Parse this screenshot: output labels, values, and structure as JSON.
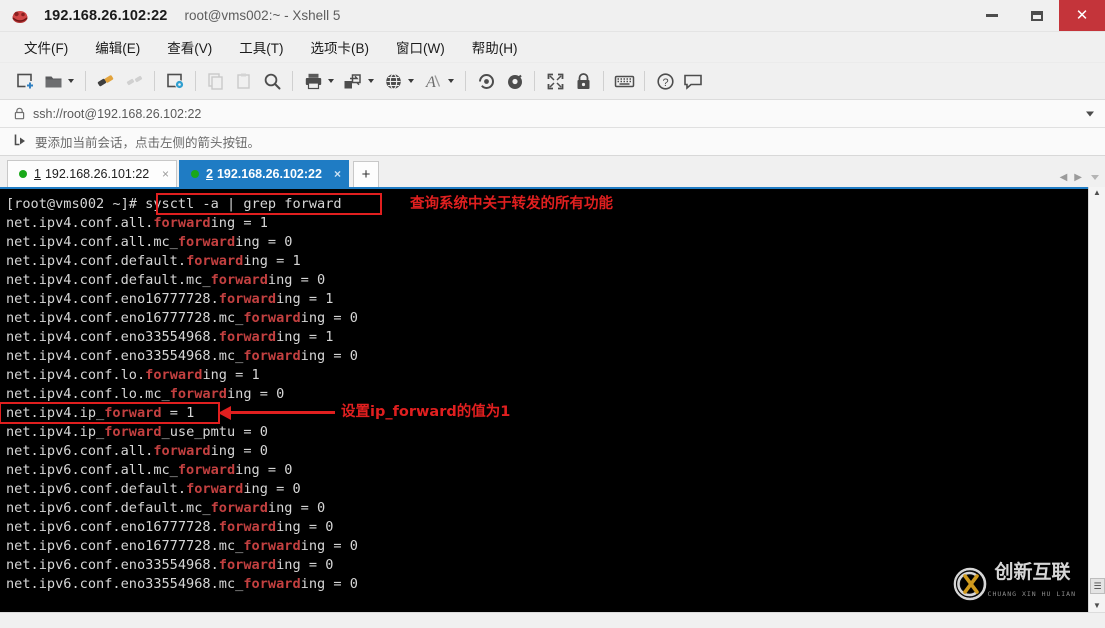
{
  "window": {
    "host": "192.168.26.102:22",
    "subtitle": "root@vms002:~ - Xshell 5",
    "app_icon": "xshell-icon",
    "minimize_label": "—",
    "maximize_label": "□",
    "close_label": "✕"
  },
  "menubar": {
    "items": [
      {
        "name": "file",
        "label": "文件(F)"
      },
      {
        "name": "edit",
        "label": "编辑(E)"
      },
      {
        "name": "view",
        "label": "查看(V)"
      },
      {
        "name": "tools",
        "label": "工具(T)"
      },
      {
        "name": "tabs",
        "label": "选项卡(B)"
      },
      {
        "name": "window",
        "label": "窗口(W)"
      },
      {
        "name": "help",
        "label": "帮助(H)"
      }
    ]
  },
  "toolbar": {
    "items": [
      {
        "name": "new-session-icon",
        "kind": "icon",
        "caret": false
      },
      {
        "name": "open-folder-icon",
        "kind": "icon",
        "caret": true
      },
      {
        "name": "separator",
        "kind": "sep"
      },
      {
        "name": "connect-icon",
        "kind": "icon",
        "caret": false
      },
      {
        "name": "disconnect-icon",
        "kind": "icon",
        "caret": false,
        "dim": true
      },
      {
        "name": "separator",
        "kind": "sep"
      },
      {
        "name": "session-properties-icon",
        "kind": "icon",
        "caret": false
      },
      {
        "name": "separator",
        "kind": "sep"
      },
      {
        "name": "copy-icon",
        "kind": "icon",
        "caret": false,
        "dim": true
      },
      {
        "name": "paste-icon",
        "kind": "icon",
        "caret": false,
        "dim": true
      },
      {
        "name": "find-icon",
        "kind": "icon",
        "caret": false
      },
      {
        "name": "separator",
        "kind": "sep"
      },
      {
        "name": "print-icon",
        "kind": "icon",
        "caret": true
      },
      {
        "name": "file-transfer-icon",
        "kind": "icon",
        "caret": true
      },
      {
        "name": "encoding-globe-icon",
        "kind": "icon",
        "caret": true
      },
      {
        "name": "font-icon",
        "kind": "icon",
        "caret": true
      },
      {
        "name": "separator",
        "kind": "sep"
      },
      {
        "name": "compose-bar-icon",
        "kind": "icon",
        "caret": false
      },
      {
        "name": "highlight-icon",
        "kind": "icon",
        "caret": false
      },
      {
        "name": "separator",
        "kind": "sep"
      },
      {
        "name": "fullscreen-icon",
        "kind": "icon",
        "caret": false
      },
      {
        "name": "lock-icon",
        "kind": "icon",
        "caret": false
      },
      {
        "name": "separator",
        "kind": "sep"
      },
      {
        "name": "keyboard-icon",
        "kind": "icon",
        "caret": false
      },
      {
        "name": "separator",
        "kind": "sep"
      },
      {
        "name": "help-icon",
        "kind": "icon",
        "caret": false
      },
      {
        "name": "feedback-icon",
        "kind": "icon",
        "caret": false
      }
    ]
  },
  "address": {
    "value": "ssh://root@192.168.26.102:22",
    "lock_icon": "lock-icon",
    "dropdown_icon": "chevron-down-icon"
  },
  "hint": {
    "icon": "arrow-add-icon",
    "text": "要添加当前会话，点击左侧的箭头按钮。"
  },
  "tabs": {
    "items": [
      {
        "name": "tab-101",
        "num": "1",
        "label": "192.168.26.101:22",
        "active": false,
        "close_label": "×"
      },
      {
        "name": "tab-102",
        "num": "2",
        "label": "192.168.26.102:22",
        "active": true,
        "close_label": "×"
      }
    ],
    "add_label": "+",
    "nav_prev": "◀",
    "nav_next": "▶"
  },
  "terminal": {
    "prompt": "[root@vms002 ~]# ",
    "command": "sysctl -a | grep forward",
    "lines": [
      [
        [
          "plain",
          "net.ipv4.conf.all."
        ],
        [
          "hl",
          "forward"
        ],
        [
          "plain",
          "ing = 1"
        ]
      ],
      [
        [
          "plain",
          "net.ipv4.conf.all.mc_"
        ],
        [
          "hl",
          "forward"
        ],
        [
          "plain",
          "ing = 0"
        ]
      ],
      [
        [
          "plain",
          "net.ipv4.conf.default."
        ],
        [
          "hl",
          "forward"
        ],
        [
          "plain",
          "ing = 1"
        ]
      ],
      [
        [
          "plain",
          "net.ipv4.conf.default.mc_"
        ],
        [
          "hl",
          "forward"
        ],
        [
          "plain",
          "ing = 0"
        ]
      ],
      [
        [
          "plain",
          "net.ipv4.conf.eno16777728."
        ],
        [
          "hl",
          "forward"
        ],
        [
          "plain",
          "ing = 1"
        ]
      ],
      [
        [
          "plain",
          "net.ipv4.conf.eno16777728.mc_"
        ],
        [
          "hl",
          "forward"
        ],
        [
          "plain",
          "ing = 0"
        ]
      ],
      [
        [
          "plain",
          "net.ipv4.conf.eno33554968."
        ],
        [
          "hl",
          "forward"
        ],
        [
          "plain",
          "ing = 1"
        ]
      ],
      [
        [
          "plain",
          "net.ipv4.conf.eno33554968.mc_"
        ],
        [
          "hl",
          "forward"
        ],
        [
          "plain",
          "ing = 0"
        ]
      ],
      [
        [
          "plain",
          "net.ipv4.conf.lo."
        ],
        [
          "hl",
          "forward"
        ],
        [
          "plain",
          "ing = 1"
        ]
      ],
      [
        [
          "plain",
          "net.ipv4.conf.lo.mc_"
        ],
        [
          "hl",
          "forward"
        ],
        [
          "plain",
          "ing = 0"
        ]
      ],
      [
        [
          "plain",
          "net.ipv4.ip_"
        ],
        [
          "hl",
          "forward"
        ],
        [
          "plain",
          " = 1"
        ]
      ],
      [
        [
          "plain",
          "net.ipv4.ip_"
        ],
        [
          "hl",
          "forward"
        ],
        [
          "plain",
          "_use_pmtu = 0"
        ]
      ],
      [
        [
          "plain",
          "net.ipv6.conf.all."
        ],
        [
          "hl",
          "forward"
        ],
        [
          "plain",
          "ing = 0"
        ]
      ],
      [
        [
          "plain",
          "net.ipv6.conf.all.mc_"
        ],
        [
          "hl",
          "forward"
        ],
        [
          "plain",
          "ing = 0"
        ]
      ],
      [
        [
          "plain",
          "net.ipv6.conf.default."
        ],
        [
          "hl",
          "forward"
        ],
        [
          "plain",
          "ing = 0"
        ]
      ],
      [
        [
          "plain",
          "net.ipv6.conf.default.mc_"
        ],
        [
          "hl",
          "forward"
        ],
        [
          "plain",
          "ing = 0"
        ]
      ],
      [
        [
          "plain",
          "net.ipv6.conf.eno16777728."
        ],
        [
          "hl",
          "forward"
        ],
        [
          "plain",
          "ing = 0"
        ]
      ],
      [
        [
          "plain",
          "net.ipv6.conf.eno16777728.mc_"
        ],
        [
          "hl",
          "forward"
        ],
        [
          "plain",
          "ing = 0"
        ]
      ],
      [
        [
          "plain",
          "net.ipv6.conf.eno33554968."
        ],
        [
          "hl",
          "forward"
        ],
        [
          "plain",
          "ing = 0"
        ]
      ],
      [
        [
          "plain",
          "net.ipv6.conf.eno33554968.mc_"
        ],
        [
          "hl",
          "forward"
        ],
        [
          "plain",
          "ing = 0"
        ]
      ]
    ]
  },
  "annotations": [
    {
      "name": "annotation-query-forward",
      "text": "查询系统中关于转发的所有功能"
    },
    {
      "name": "annotation-set-ip-forward",
      "text": "设置ip_forward的值为1"
    }
  ],
  "watermark": {
    "text": "创新互联",
    "subtext": "CHUANG XIN HU LIAN"
  },
  "scrollbar": {
    "up_label": "▲",
    "down_label": "▼"
  },
  "colors": {
    "accent": "#1f7cc4",
    "annotation_red": "#e01f1f",
    "grep_red": "#c34040",
    "terminal_fg": "#d6d6d6",
    "terminal_bg": "#000000",
    "close_button": "#c4343a"
  }
}
